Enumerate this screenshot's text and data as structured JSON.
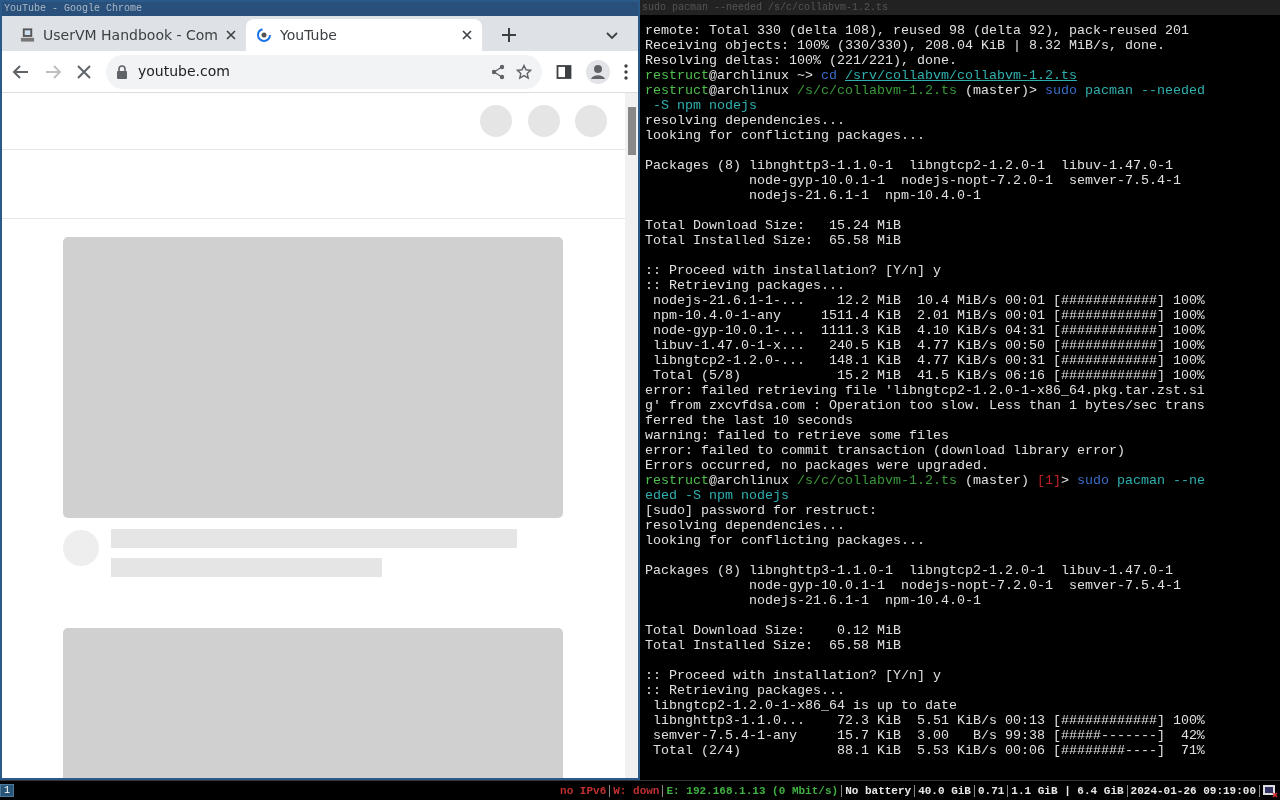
{
  "browser": {
    "window_title": "YouTube - Google Chrome",
    "tabs": [
      {
        "label": "UserVM Handbook - Com",
        "selected": false
      },
      {
        "label": "YouTube",
        "selected": true
      }
    ],
    "address": "youtube.com"
  },
  "terminal": {
    "title": "sudo pacman --needed /s/c/collabvm-1.2.ts",
    "lines": [
      {
        "kind": "text",
        "segments": [
          {
            "text": "remote: Total 330 (delta 108), reused 98 (delta 92), pack-reused 201",
            "kind": "plain"
          }
        ]
      },
      {
        "kind": "text",
        "segments": [
          {
            "text": "Receiving objects: 100% (330/330), 208.04 KiB | 8.32 MiB/s, done.",
            "kind": "plain"
          }
        ]
      },
      {
        "kind": "text",
        "segments": [
          {
            "text": "Resolving deltas: 100% (221/221), done.",
            "kind": "plain"
          }
        ]
      },
      {
        "kind": "text",
        "segments": [
          {
            "text": "restruct",
            "kind": "user"
          },
          {
            "text": "@archlinux ~> ",
            "kind": "plain"
          },
          {
            "text": "cd ",
            "kind": "cmd"
          },
          {
            "text": "/srv/collabvm/collabvm-1.2.ts",
            "kind": "link"
          }
        ]
      },
      {
        "kind": "text",
        "segments": [
          {
            "text": "restruct",
            "kind": "user"
          },
          {
            "text": "@archlinux ",
            "kind": "plain"
          },
          {
            "text": "/s/c/collabvm-1.2.ts",
            "kind": "path"
          },
          {
            "text": " (master)> ",
            "kind": "plain"
          },
          {
            "text": "sudo",
            "kind": "cmd"
          },
          {
            "text": " pacman --needed",
            "kind": "arg"
          }
        ]
      },
      {
        "kind": "text",
        "segments": [
          {
            "text": " -S npm nodejs",
            "kind": "arg"
          }
        ]
      },
      {
        "kind": "text",
        "segments": [
          {
            "text": "resolving dependencies...",
            "kind": "plain"
          }
        ]
      },
      {
        "kind": "text",
        "segments": [
          {
            "text": "looking for conflicting packages...",
            "kind": "plain"
          }
        ]
      },
      {
        "kind": "blank"
      },
      {
        "kind": "text",
        "segments": [
          {
            "text": "Packages (8) libnghttp3-1.1.0-1  libngtcp2-1.2.0-1  libuv-1.47.0-1",
            "kind": "plain"
          }
        ]
      },
      {
        "kind": "text",
        "segments": [
          {
            "text": "             node-gyp-10.0.1-1  nodejs-nopt-7.2.0-1  semver-7.5.4-1",
            "kind": "plain"
          }
        ]
      },
      {
        "kind": "text",
        "segments": [
          {
            "text": "             nodejs-21.6.1-1  npm-10.4.0-1",
            "kind": "plain"
          }
        ]
      },
      {
        "kind": "blank"
      },
      {
        "kind": "text",
        "segments": [
          {
            "text": "Total Download Size:   15.24 MiB",
            "kind": "plain"
          }
        ]
      },
      {
        "kind": "text",
        "segments": [
          {
            "text": "Total Installed Size:  65.58 MiB",
            "kind": "plain"
          }
        ]
      },
      {
        "kind": "blank"
      },
      {
        "kind": "text",
        "segments": [
          {
            "text": ":: Proceed with installation? [Y/n] y",
            "kind": "plain"
          }
        ]
      },
      {
        "kind": "text",
        "segments": [
          {
            "text": ":: Retrieving packages...",
            "kind": "plain"
          }
        ]
      },
      {
        "kind": "text",
        "segments": [
          {
            "text": " nodejs-21.6.1-1-...    12.2 MiB  10.4 MiB/s 00:01 [############] 100%",
            "kind": "plain"
          }
        ]
      },
      {
        "kind": "text",
        "segments": [
          {
            "text": " npm-10.4.0-1-any     1511.4 KiB  2.01 MiB/s 00:01 [############] 100%",
            "kind": "plain"
          }
        ]
      },
      {
        "kind": "text",
        "segments": [
          {
            "text": " node-gyp-10.0.1-...  1111.3 KiB  4.10 KiB/s 04:31 [############] 100%",
            "kind": "plain"
          }
        ]
      },
      {
        "kind": "text",
        "segments": [
          {
            "text": " libuv-1.47.0-1-x...   240.5 KiB  4.77 KiB/s 00:50 [############] 100%",
            "kind": "plain"
          }
        ]
      },
      {
        "kind": "text",
        "segments": [
          {
            "text": " libngtcp2-1.2.0-...   148.1 KiB  4.77 KiB/s 00:31 [############] 100%",
            "kind": "plain"
          }
        ]
      },
      {
        "kind": "text",
        "segments": [
          {
            "text": " Total (5/8)            15.2 MiB  41.5 KiB/s 06:16 [############] 100%",
            "kind": "plain"
          }
        ]
      },
      {
        "kind": "text",
        "segments": [
          {
            "text": "error: failed retrieving file 'libngtcp2-1.2.0-1-x86_64.pkg.tar.zst.si",
            "kind": "plain"
          }
        ]
      },
      {
        "kind": "text",
        "segments": [
          {
            "text": "g' from zxcvfdsa.com : Operation too slow. Less than 1 bytes/sec trans",
            "kind": "plain"
          }
        ]
      },
      {
        "kind": "text",
        "segments": [
          {
            "text": "ferred the last 10 seconds",
            "kind": "plain"
          }
        ]
      },
      {
        "kind": "text",
        "segments": [
          {
            "text": "warning: failed to retrieve some files",
            "kind": "plain"
          }
        ]
      },
      {
        "kind": "text",
        "segments": [
          {
            "text": "error: failed to commit transaction (download library error)",
            "kind": "plain"
          }
        ]
      },
      {
        "kind": "text",
        "segments": [
          {
            "text": "Errors occurred, no packages were upgraded.",
            "kind": "plain"
          }
        ]
      },
      {
        "kind": "text",
        "segments": [
          {
            "text": "restruct",
            "kind": "user"
          },
          {
            "text": "@archlinux ",
            "kind": "plain"
          },
          {
            "text": "/s/c/collabvm-1.2.ts",
            "kind": "path"
          },
          {
            "text": " (master) ",
            "kind": "plain"
          },
          {
            "text": "[1]",
            "kind": "status"
          },
          {
            "text": "> ",
            "kind": "plain"
          },
          {
            "text": "sudo",
            "kind": "cmd"
          },
          {
            "text": " pacman --ne",
            "kind": "arg"
          }
        ]
      },
      {
        "kind": "text",
        "segments": [
          {
            "text": "eded -S npm nodejs",
            "kind": "arg"
          }
        ]
      },
      {
        "kind": "text",
        "segments": [
          {
            "text": "[sudo] password for restruct:",
            "kind": "plain"
          }
        ]
      },
      {
        "kind": "text",
        "segments": [
          {
            "text": "resolving dependencies...",
            "kind": "plain"
          }
        ]
      },
      {
        "kind": "text",
        "segments": [
          {
            "text": "looking for conflicting packages...",
            "kind": "plain"
          }
        ]
      },
      {
        "kind": "blank"
      },
      {
        "kind": "text",
        "segments": [
          {
            "text": "Packages (8) libnghttp3-1.1.0-1  libngtcp2-1.2.0-1  libuv-1.47.0-1",
            "kind": "plain"
          }
        ]
      },
      {
        "kind": "text",
        "segments": [
          {
            "text": "             node-gyp-10.0.1-1  nodejs-nopt-7.2.0-1  semver-7.5.4-1",
            "kind": "plain"
          }
        ]
      },
      {
        "kind": "text",
        "segments": [
          {
            "text": "             nodejs-21.6.1-1  npm-10.4.0-1",
            "kind": "plain"
          }
        ]
      },
      {
        "kind": "blank"
      },
      {
        "kind": "text",
        "segments": [
          {
            "text": "Total Download Size:    0.12 MiB",
            "kind": "plain"
          }
        ]
      },
      {
        "kind": "text",
        "segments": [
          {
            "text": "Total Installed Size:  65.58 MiB",
            "kind": "plain"
          }
        ]
      },
      {
        "kind": "blank"
      },
      {
        "kind": "text",
        "segments": [
          {
            "text": ":: Proceed with installation? [Y/n] y",
            "kind": "plain"
          }
        ]
      },
      {
        "kind": "text",
        "segments": [
          {
            "text": ":: Retrieving packages...",
            "kind": "plain"
          }
        ]
      },
      {
        "kind": "text",
        "segments": [
          {
            "text": " libngtcp2-1.2.0-1-x86_64 is up to date",
            "kind": "plain"
          }
        ]
      },
      {
        "kind": "text",
        "segments": [
          {
            "text": " libnghttp3-1.1.0...    72.3 KiB  5.51 KiB/s 00:13 [############] 100%",
            "kind": "plain"
          }
        ]
      },
      {
        "kind": "text",
        "segments": [
          {
            "text": " semver-7.5.4-1-any     15.7 KiB  3.00   B/s 99:38 [#####-------]  42%",
            "kind": "plain"
          }
        ]
      },
      {
        "kind": "text",
        "segments": [
          {
            "text": " Total (2/4)            88.1 KiB  5.53 KiB/s 00:06 [########----]  71%",
            "kind": "plain"
          }
        ]
      }
    ]
  },
  "status_bar": {
    "workspace": {
      "label": "1",
      "selected": true
    },
    "items": [
      {
        "text": "no IPv6",
        "color": "#c03030"
      },
      {
        "text": "W: down",
        "color": "#c03030"
      },
      {
        "text": "E: 192.168.1.13 (0 Mbit/s)",
        "color": "#40b040"
      },
      {
        "text": "No battery",
        "color": "#e8e8e8"
      },
      {
        "text": "40.0 GiB",
        "color": "#e8e8e8"
      },
      {
        "text": "0.71",
        "color": "#e8e8e8"
      },
      {
        "text": "1.1 GiB | 6.4 GiB",
        "color": "#e8e8e8"
      },
      {
        "text": "2024-01-26 09:19:00",
        "color": "#e8e8e8"
      }
    ]
  }
}
